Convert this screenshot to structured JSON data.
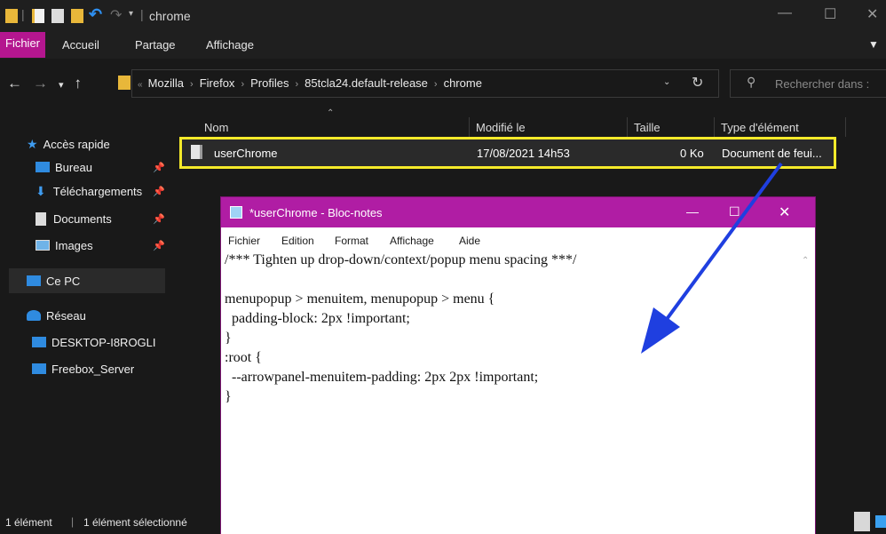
{
  "window": {
    "title": "chrome"
  },
  "ribbon": {
    "tabs": [
      "Fichier",
      "Accueil",
      "Partage",
      "Affichage"
    ],
    "collapse_icon": "chevron-down-icon"
  },
  "address": {
    "crumbs": [
      "Mozilla",
      "Firefox",
      "Profiles",
      "85tcla24.default-release",
      "chrome"
    ],
    "search_placeholder": "Rechercher dans :"
  },
  "sidebar": {
    "quick_access": "Accès rapide",
    "items": [
      {
        "label": "Bureau",
        "icon": "desktop-icon",
        "pinned": true
      },
      {
        "label": "Téléchargements",
        "icon": "download-icon",
        "pinned": true
      },
      {
        "label": "Documents",
        "icon": "document-icon",
        "pinned": true
      },
      {
        "label": "Images",
        "icon": "image-icon",
        "pinned": true
      }
    ],
    "this_pc": "Ce PC",
    "network": "Réseau",
    "network_items": [
      "DESKTOP-I8ROGLI",
      "Freebox_Server"
    ]
  },
  "filelist": {
    "columns": [
      "Nom",
      "Modifié le",
      "Taille",
      "Type d'élément"
    ],
    "rows": [
      {
        "name": "userChrome",
        "modified": "17/08/2021 14h53",
        "size": "0 Ko",
        "type": "Document de feui..."
      }
    ]
  },
  "status": {
    "count": "1 élément",
    "selected": "1 élément sélectionné"
  },
  "notepad": {
    "title": "*userChrome - Bloc-notes",
    "menu": [
      "Fichier",
      "Edition",
      "Format",
      "Affichage",
      "Aide"
    ],
    "lines": [
      "/*** Tighten up drop-down/context/popup menu spacing ***/",
      "",
      "menupopup > menuitem, menupopup > menu {",
      "  padding-block: 2px !important;",
      "}",
      ":root {",
      "  --arrowpanel-menuitem-padding: 2px 2px !important;",
      "}"
    ]
  },
  "colors": {
    "accent_ribbon": "#b4168f",
    "notepad_titlebar": "#b01da4",
    "highlight": "#f5ea2a",
    "arrow": "#1f3fe0"
  }
}
